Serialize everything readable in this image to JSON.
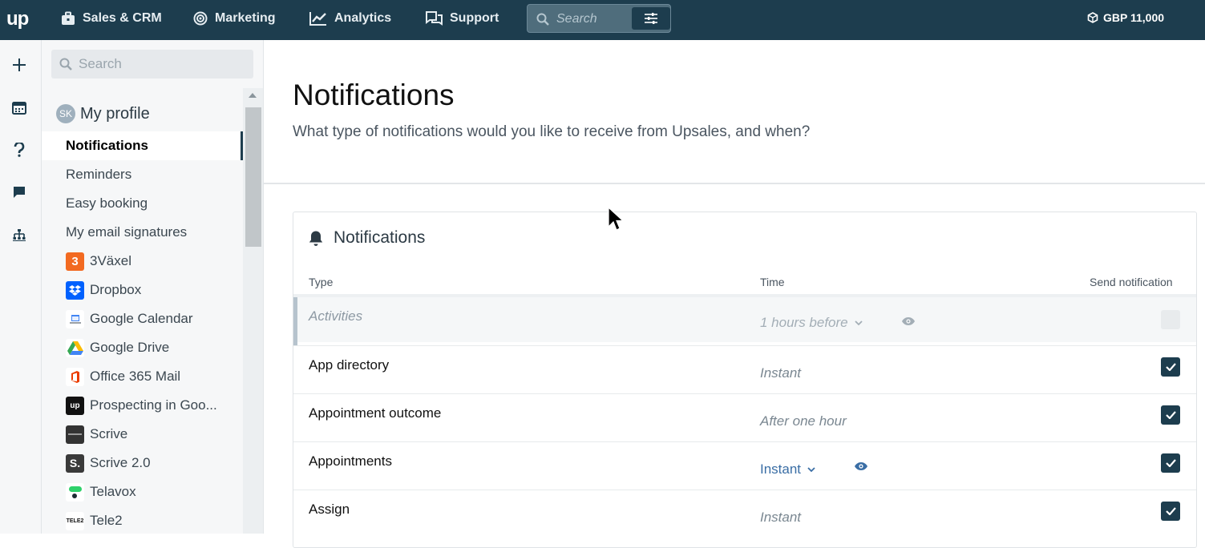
{
  "topbar": {
    "logo": "up",
    "nav": [
      {
        "label": "Sales & CRM",
        "icon": "briefcase-icon"
      },
      {
        "label": "Marketing",
        "icon": "target-icon"
      },
      {
        "label": "Analytics",
        "icon": "chart-icon"
      },
      {
        "label": "Support",
        "icon": "chat-icon"
      }
    ],
    "search_placeholder": "Search",
    "balance": "GBP 11,000"
  },
  "rail": [
    "plus-icon",
    "calendar-icon",
    "help-icon",
    "message-icon",
    "sitemap-icon"
  ],
  "sidebar": {
    "search_placeholder": "Search",
    "profile": {
      "initials": "SK",
      "label": "My profile"
    },
    "items": [
      {
        "label": "Notifications",
        "active": true
      },
      {
        "label": "Reminders"
      },
      {
        "label": "Easy booking"
      },
      {
        "label": "My email signatures"
      }
    ],
    "apps": [
      {
        "label": "3Växel",
        "logo": "3",
        "color": "#f26a21"
      },
      {
        "label": "Dropbox",
        "logo": "dropbox",
        "color": "#0061fe"
      },
      {
        "label": "Google Calendar",
        "logo": "gcal",
        "color": "#ffffff"
      },
      {
        "label": "Google Drive",
        "logo": "gdrive",
        "color": "#ffffff"
      },
      {
        "label": "Office 365 Mail",
        "logo": "o365",
        "color": "#ffffff"
      },
      {
        "label": "Prospecting in Goo...",
        "logo": "up",
        "color": "#111111"
      },
      {
        "label": "Scrive",
        "logo": "scrive",
        "color": "#333333"
      },
      {
        "label": "Scrive 2.0",
        "logo": "S.",
        "color": "#3a3a3a"
      },
      {
        "label": "Telavox",
        "logo": "telavox",
        "color": "#ffffff"
      },
      {
        "label": "Tele2",
        "logo": "TELE2",
        "color": "#ffffff"
      }
    ]
  },
  "main": {
    "title": "Notifications",
    "subtitle": "What type of notifications would you like to receive from Upsales, and when?",
    "card": {
      "title": "Notifications",
      "columns": {
        "type": "Type",
        "time": "Time",
        "send": "Send notification"
      },
      "rows": [
        {
          "type": "Activities",
          "time": "1 hours before",
          "state": "disabled",
          "checked": false
        },
        {
          "type": "App directory",
          "time": "Instant",
          "state": "normal",
          "checked": true
        },
        {
          "type": "Appointment outcome",
          "time": "After one hour",
          "state": "normal",
          "checked": true
        },
        {
          "type": "Appointments",
          "time": "Instant",
          "state": "active",
          "checked": true
        },
        {
          "type": "Assign",
          "time": "Instant",
          "state": "normal",
          "checked": true
        }
      ]
    }
  }
}
